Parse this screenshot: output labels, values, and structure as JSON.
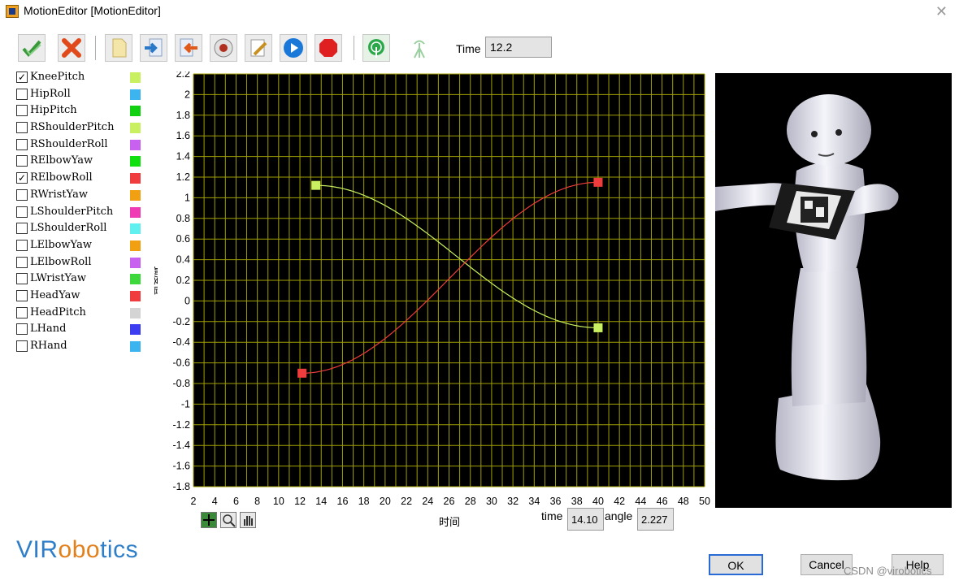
{
  "window": {
    "title": "MotionEditor [MotionEditor]"
  },
  "toolbar": {
    "buttons": [
      {
        "name": "confirm-icon",
        "color": "#3a9a3a"
      },
      {
        "name": "cancel-icon",
        "color": "#e04a1a"
      },
      {
        "name": "new-document-icon",
        "color": "#f4e6a8"
      },
      {
        "name": "import-icon",
        "color": "#2a78c8"
      },
      {
        "name": "export-icon",
        "color": "#e05a1a"
      },
      {
        "name": "record-icon",
        "color": "#b03020"
      },
      {
        "name": "edit-icon",
        "color": "#c89020"
      },
      {
        "name": "play-icon",
        "color": "#1a78d8"
      },
      {
        "name": "stop-icon",
        "color": "#e02020"
      },
      {
        "name": "connected-robot-icon",
        "color": "#2aa84a"
      },
      {
        "name": "disconnected-robot-icon",
        "color": "#9ad0a0"
      }
    ],
    "time_label": "Time",
    "time_value": "12.2"
  },
  "joints": [
    {
      "label": "KneePitch",
      "checked": true,
      "color": "#c8f060"
    },
    {
      "label": "HipRoll",
      "checked": false,
      "color": "#3cb4f0"
    },
    {
      "label": "HipPitch",
      "checked": false,
      "color": "#10d010"
    },
    {
      "label": "RShoulderPitch",
      "checked": false,
      "color": "#c8f060"
    },
    {
      "label": "RShoulderRoll",
      "checked": false,
      "color": "#c860f0"
    },
    {
      "label": "RElbowYaw",
      "checked": false,
      "color": "#10e010"
    },
    {
      "label": "RElbowRoll",
      "checked": true,
      "color": "#f03c3c"
    },
    {
      "label": "RWristYaw",
      "checked": false,
      "color": "#f0a010"
    },
    {
      "label": "LShoulderPitch",
      "checked": false,
      "color": "#f03cb4"
    },
    {
      "label": "LShoulderRoll",
      "checked": false,
      "color": "#60f0f0"
    },
    {
      "label": "LElbowYaw",
      "checked": false,
      "color": "#f0a010"
    },
    {
      "label": "LElbowRoll",
      "checked": false,
      "color": "#c860f0"
    },
    {
      "label": "LWristYaw",
      "checked": false,
      "color": "#3cd83c"
    },
    {
      "label": "HeadYaw",
      "checked": false,
      "color": "#f03c3c"
    },
    {
      "label": "HeadPitch",
      "checked": false,
      "color": "#d4d4d4"
    },
    {
      "label": "LHand",
      "checked": false,
      "color": "#3c3cf0"
    },
    {
      "label": "RHand",
      "checked": false,
      "color": "#3cb4f0"
    }
  ],
  "chart_data": {
    "type": "line",
    "xlabel": "时间",
    "ylabel": "弧度值",
    "xlim": [
      2,
      50
    ],
    "ylim": [
      -1.8,
      2.2
    ],
    "xticks": [
      "2",
      "4",
      "6",
      "8",
      "10",
      "12",
      "14",
      "16",
      "18",
      "20",
      "22",
      "24",
      "26",
      "28",
      "30",
      "32",
      "34",
      "36",
      "38",
      "40",
      "42",
      "44",
      "46",
      "48",
      "50"
    ],
    "yticks": [
      "2.2",
      "2",
      "1.8",
      "1.6",
      "1.4",
      "1.2",
      "1",
      "0.8",
      "0.6",
      "0.4",
      "0.2",
      "0",
      "-0.2",
      "-0.4",
      "-0.6",
      "-0.8",
      "-1",
      "-1.2",
      "-1.4",
      "-1.6",
      "-1.8"
    ],
    "grid": true,
    "background": "#000000",
    "grid_color": "#a0a000",
    "series": [
      {
        "name": "KneePitch",
        "color": "#c8f060",
        "keyframes": [
          {
            "x": 13.5,
            "y": 1.12
          },
          {
            "x": 40,
            "y": -0.26
          }
        ]
      },
      {
        "name": "RElbowRoll",
        "color": "#f03c3c",
        "keyframes": [
          {
            "x": 12.2,
            "y": -0.7
          },
          {
            "x": 40,
            "y": 1.15
          }
        ]
      }
    ]
  },
  "cursor_readout": {
    "time_label": "time",
    "time_value": "14.10",
    "angle_label": "angle",
    "angle_value": "2.227"
  },
  "logo": {
    "part1": "VIR",
    "part2": "obo",
    "part3": "tics"
  },
  "dialog_buttons": {
    "ok": "OK",
    "cancel": "Cancel",
    "help": "Help"
  },
  "watermark": "CSDN @virobotics"
}
